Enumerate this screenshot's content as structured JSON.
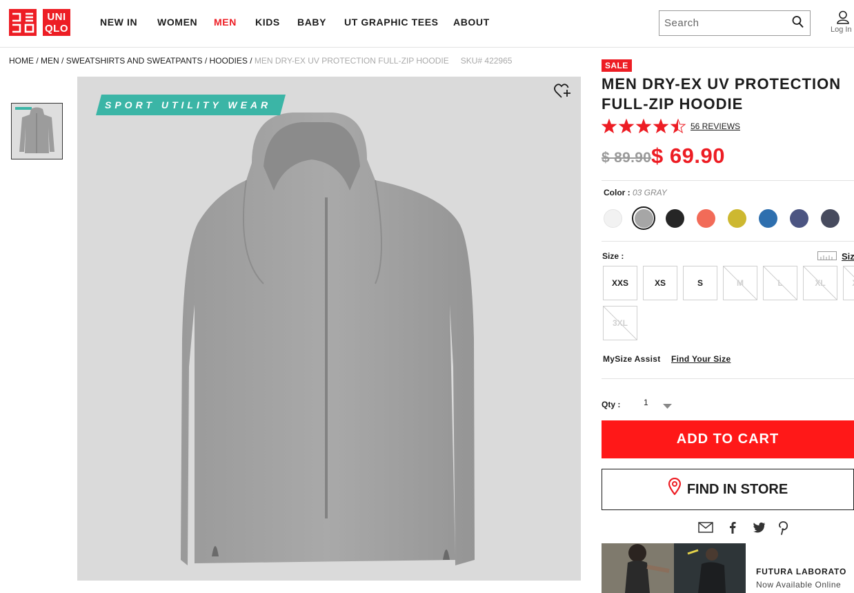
{
  "header": {
    "logo": {
      "top": "UNI",
      "bottom": "QLO"
    },
    "nav": [
      {
        "label": "NEW IN",
        "active": false
      },
      {
        "label": "WOMEN",
        "active": false
      },
      {
        "label": "MEN",
        "active": true
      },
      {
        "label": "KIDS",
        "active": false
      },
      {
        "label": "BABY",
        "active": false
      },
      {
        "label": "UT GRAPHIC TEES",
        "active": false
      },
      {
        "label": "ABOUT",
        "active": false
      }
    ],
    "search": {
      "placeholder": "Search",
      "value": ""
    },
    "login_label": "Log In"
  },
  "breadcrumb": {
    "items": [
      "HOME",
      "MEN",
      "SWEATSHIRTS AND SWEATPANTS",
      "HOODIES"
    ],
    "separator": " / ",
    "current": "MEN DRY-EX UV PROTECTION FULL-ZIP HOODIE",
    "sku": "SKU# 422965"
  },
  "gallery": {
    "banner_text": "SPORT UTILITY WEAR",
    "banner_color": "#3bb5a6"
  },
  "product": {
    "sale_badge": "SALE",
    "title": "MEN DRY-EX UV PROTECTION FULL-ZIP HOODIE",
    "rating": 4.5,
    "rating_max": 5,
    "reviews_label": "56 REVIEWS",
    "price_original": "$ 89.90",
    "price_sale": "$ 69.90",
    "color_label": "Color :",
    "color_value": "03 GRAY",
    "swatches": [
      {
        "name": "white",
        "color": "#f2f2f2",
        "selected": false
      },
      {
        "name": "gray",
        "color": "#a6a6a6",
        "selected": true
      },
      {
        "name": "black",
        "color": "#262626",
        "selected": false
      },
      {
        "name": "orange",
        "color": "#f26b58",
        "selected": false
      },
      {
        "name": "yellow",
        "color": "#cdb830",
        "selected": false
      },
      {
        "name": "blue",
        "color": "#2e6fae",
        "selected": false
      },
      {
        "name": "navy",
        "color": "#4c5582",
        "selected": false
      },
      {
        "name": "dark-navy",
        "color": "#474b5e",
        "selected": false
      }
    ],
    "size_label": "Size :",
    "size_chart_label": "Size",
    "sizes": [
      {
        "label": "XXS",
        "available": true
      },
      {
        "label": "XS",
        "available": true
      },
      {
        "label": "S",
        "available": true
      },
      {
        "label": "M",
        "available": false
      },
      {
        "label": "L",
        "available": false
      },
      {
        "label": "XL",
        "available": false
      },
      {
        "label": "XXL",
        "available": false
      },
      {
        "label": "3XL",
        "available": false
      }
    ],
    "mysize_label": "MySize Assist",
    "mysize_link": "Find Your Size",
    "qty_label": "Qty :",
    "qty_value": "1",
    "add_to_cart": "ADD TO CART",
    "find_in_store": "FIND IN STORE"
  },
  "promo": {
    "title": "FUTURA LABORATO",
    "subtitle": "Now Available Online"
  },
  "colors": {
    "brand_red": "#ed1d24",
    "cta_red": "#ff1818"
  }
}
